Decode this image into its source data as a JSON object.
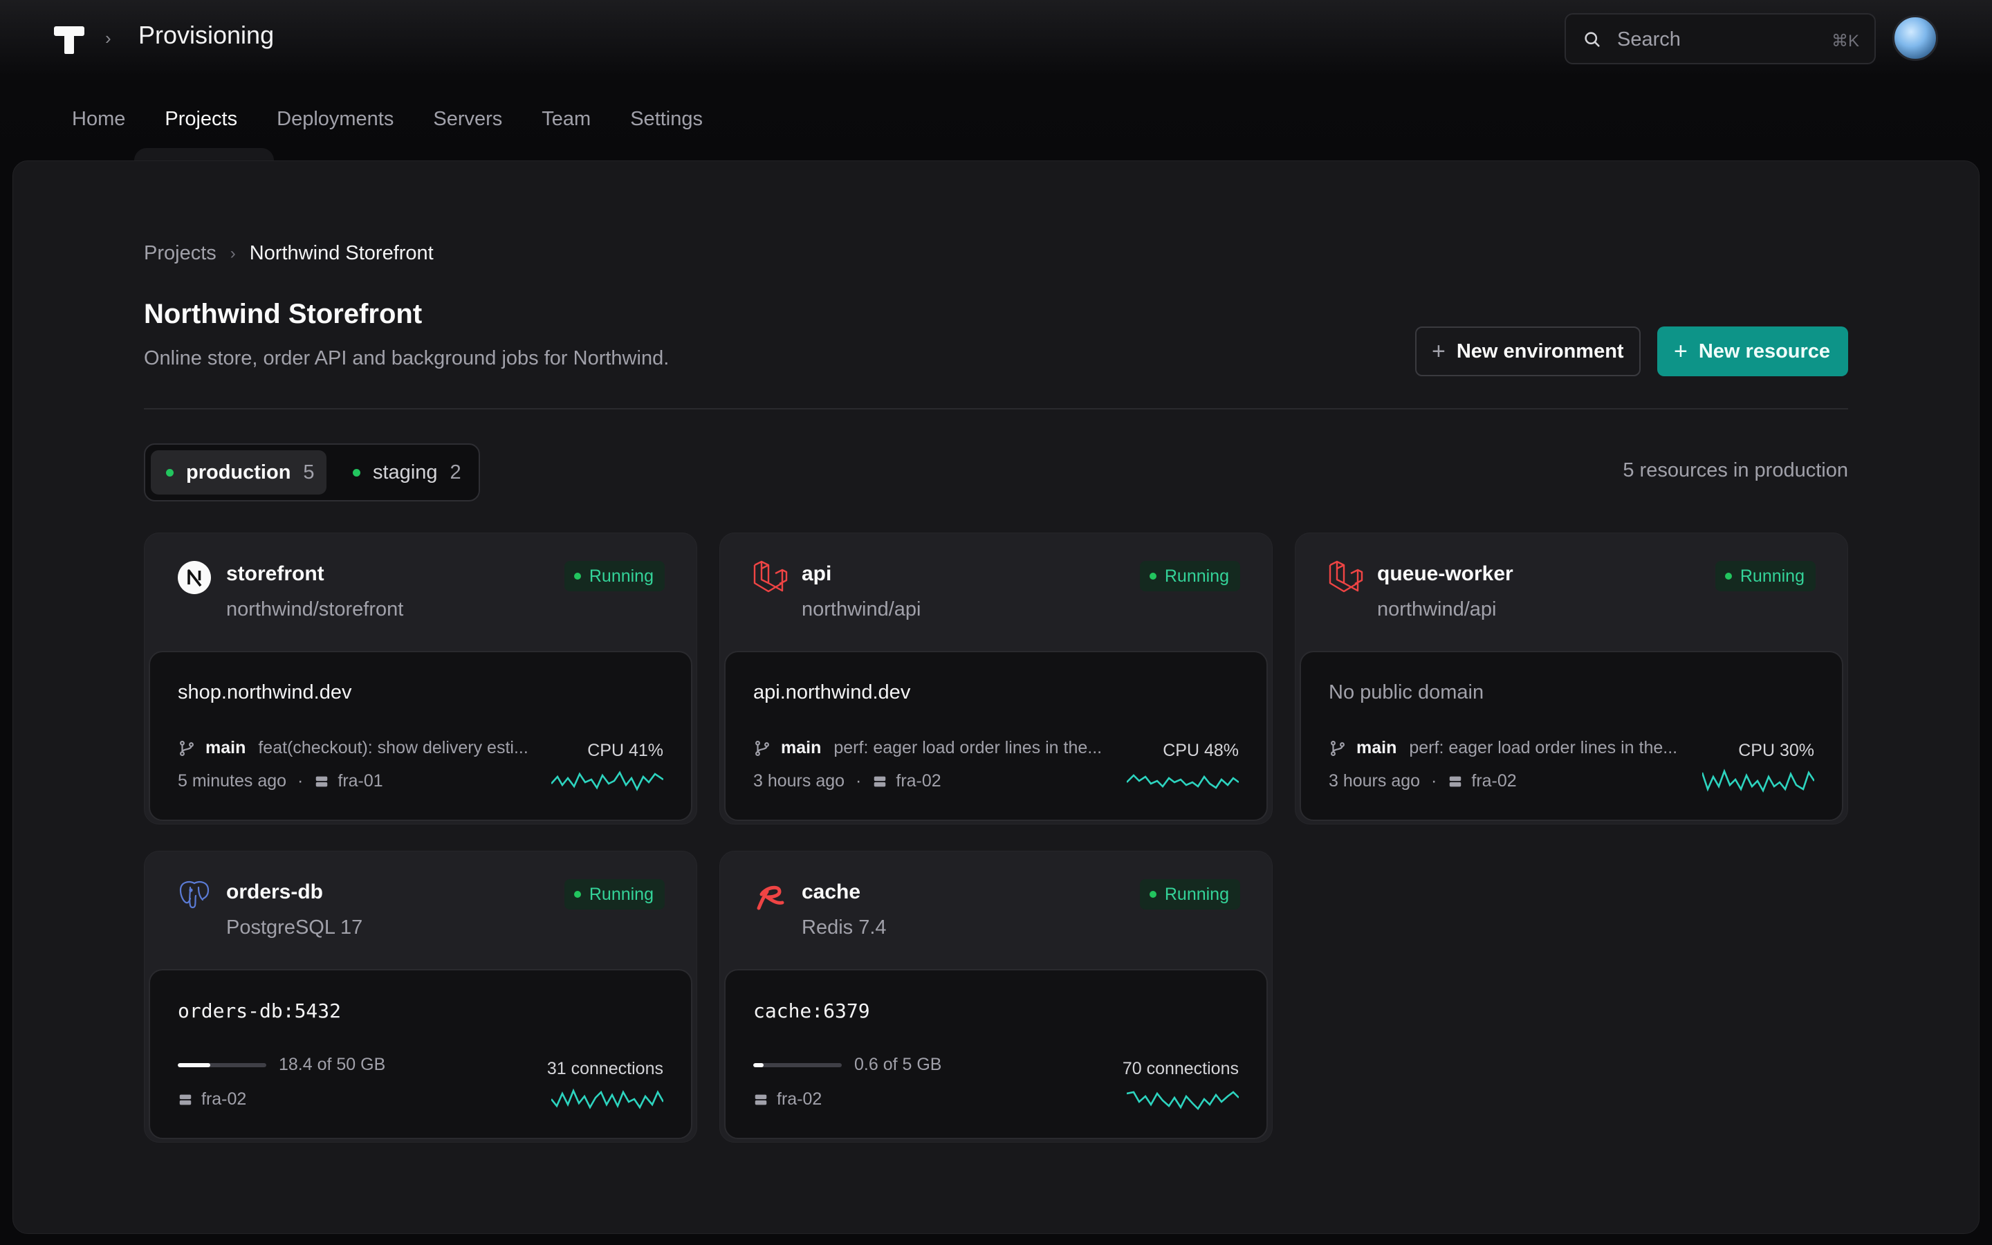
{
  "app": {
    "title": "Provisioning",
    "search_placeholder": "Search",
    "search_shortcut": "⌘K"
  },
  "nav": [
    {
      "label": "Home",
      "active": false
    },
    {
      "label": "Projects",
      "active": true
    },
    {
      "label": "Deployments",
      "active": false
    },
    {
      "label": "Servers",
      "active": false
    },
    {
      "label": "Team",
      "active": false
    },
    {
      "label": "Settings",
      "active": false
    }
  ],
  "breadcrumb": {
    "parent": "Projects",
    "current": "Northwind Storefront"
  },
  "project": {
    "title": "Northwind Storefront",
    "description": "Online store, order API and background jobs for Northwind."
  },
  "actions": {
    "new_environment": "New environment",
    "new_resource": "New resource"
  },
  "environments": [
    {
      "name": "production",
      "count": "5",
      "selected": true
    },
    {
      "name": "staging",
      "count": "2",
      "selected": false
    }
  ],
  "resource_count_text": "5 resources in production",
  "colors": {
    "accent": "#0d9488",
    "running": "#22c55e",
    "laravel": "#ef4444",
    "redis": "#ef4444",
    "postgres": "#5b7bd5",
    "spark": "#2dd4bf"
  },
  "resources": [
    {
      "name": "storefront",
      "subtitle": "northwind/storefront",
      "status": "Running",
      "icon": "nextjs-icon",
      "domain": "shop.northwind.dev",
      "branch": "main",
      "commit": "feat(checkout): show delivery esti...",
      "time": "5 minutes ago",
      "server": "fra-01",
      "metric": "CPU 41%"
    },
    {
      "name": "api",
      "subtitle": "northwind/api",
      "status": "Running",
      "icon": "laravel-icon",
      "domain": "api.northwind.dev",
      "branch": "main",
      "commit": "perf: eager load order lines in the...",
      "time": "3 hours ago",
      "server": "fra-02",
      "metric": "CPU 48%"
    },
    {
      "name": "queue-worker",
      "subtitle": "northwind/api",
      "status": "Running",
      "icon": "laravel-icon",
      "domain": "No public domain",
      "branch": "main",
      "commit": "perf: eager load order lines in the...",
      "time": "3 hours ago",
      "server": "fra-02",
      "metric": "CPU 30%"
    },
    {
      "name": "orders-db",
      "subtitle": "PostgreSQL 17",
      "status": "Running",
      "icon": "postgresql-icon",
      "domain": "orders-db:5432",
      "usage_text": "18.4 of 50 GB",
      "usage_fraction": 0.368,
      "server": "fra-02",
      "metric": "31 connections"
    },
    {
      "name": "cache",
      "subtitle": "Redis 7.4",
      "status": "Running",
      "icon": "redis-icon",
      "domain": "cache:6379",
      "usage_text": "0.6 of 5 GB",
      "usage_fraction": 0.12,
      "server": "fra-02",
      "metric": "70 connections"
    }
  ]
}
